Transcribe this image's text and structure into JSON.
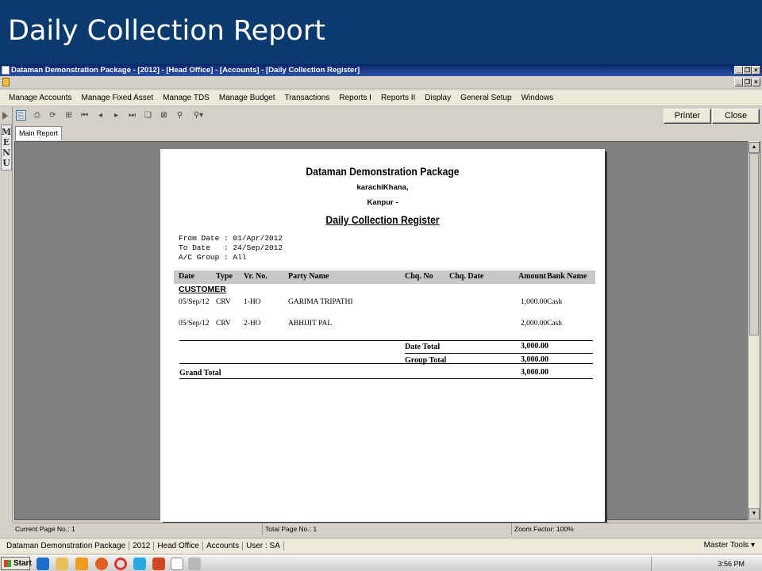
{
  "slide_title": "Daily Collection Report",
  "window": {
    "title": "Dataman Demonstration Package - [2012] - [Head Office] - [Accounts] - [Daily Collection Register]"
  },
  "menu_items": [
    "Manage Accounts",
    "Manage Fixed Asset",
    "Manage TDS",
    "Manage Budget",
    "Transactions",
    "Reports I",
    "Reports II",
    "Display",
    "General Setup",
    "Windows"
  ],
  "toolbar": {
    "printer": "Printer",
    "close": "Close"
  },
  "side_menu_label": "MENU",
  "tab": "Main Report",
  "report": {
    "company": "Dataman Demonstration Package",
    "address1": "karachiKhana,",
    "address2": "Kanpur -",
    "title": "Daily Collection Register",
    "from_date": "From Date : 01/Apr/2012",
    "to_date": "To Date   : 24/Sep/2012",
    "ac_group": "A/C Group : All",
    "headers": {
      "date": "Date",
      "type": "Type",
      "vrno": "Vr. No.",
      "party": "Party Name",
      "chqno": "Chq. No",
      "chqdate": "Chq. Date",
      "amount": "Amount",
      "bank": "Bank Name"
    },
    "group": "CUSTOMER",
    "rows": [
      {
        "date": "05/Sep/12",
        "type": "CRV",
        "vrno": "1-HO",
        "party": "GARIMA TRIPATHI",
        "chqno": "",
        "chqdate": "",
        "amount": "1,000.00",
        "bank": "Cash"
      },
      {
        "date": "05/Sep/12",
        "type": "CRV",
        "vrno": "2-HO",
        "party": "ABHIJIT PAL",
        "chqno": "",
        "chqdate": "",
        "amount": "2,000.00",
        "bank": "Cash"
      }
    ],
    "date_total_label": "Date Total",
    "date_total": "3,000.00",
    "group_total_label": "Group Total",
    "group_total": "3,000.00",
    "grand_total_label": "Grand Total",
    "grand_total": "3,000.00"
  },
  "status": {
    "current_page": "Current Page No.: 1",
    "total_page": "Total Page No.: 1",
    "zoom": "Zoom Factor: 100%"
  },
  "app_status": {
    "items": [
      "Dataman Demonstration Package",
      "2012",
      "Head Office",
      "Accounts",
      "User : SA"
    ],
    "master_tools": "Master Tools"
  },
  "taskbar": {
    "start": "Start",
    "time": "3:56 PM"
  },
  "colors": {
    "slide_header": "#0b3a6e",
    "titlebar": "#0a246a",
    "desktop": "#808080"
  }
}
